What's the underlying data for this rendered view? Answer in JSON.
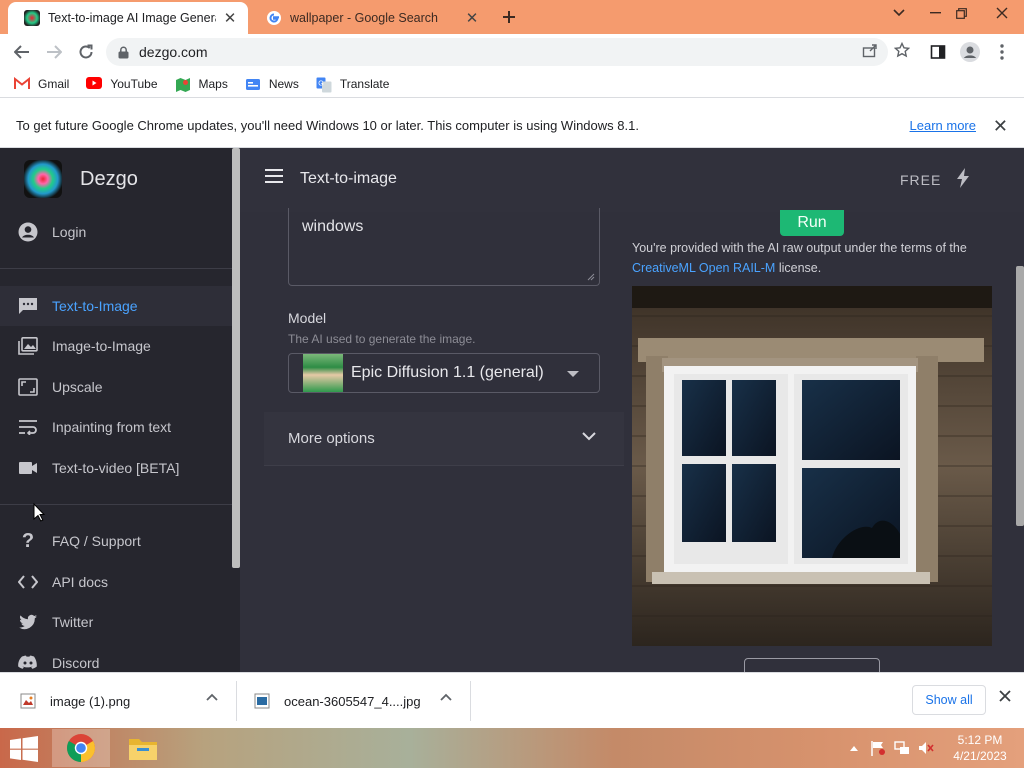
{
  "browser": {
    "tabs": [
      {
        "title": "Text-to-image AI Image Generato",
        "active": true
      },
      {
        "title": "wallpaper - Google Search",
        "active": false
      }
    ],
    "url": "dezgo.com",
    "bookmarks": [
      {
        "label": "Gmail",
        "icon": "gmail-icon"
      },
      {
        "label": "YouTube",
        "icon": "youtube-icon"
      },
      {
        "label": "Maps",
        "icon": "maps-icon"
      },
      {
        "label": "News",
        "icon": "news-icon"
      },
      {
        "label": "Translate",
        "icon": "translate-icon"
      }
    ],
    "infobar": {
      "message": "To get future Google Chrome updates, you'll need Windows 10 or later. This computer is using Windows 8.1.",
      "link": "Learn more"
    }
  },
  "app": {
    "brand": "Dezgo",
    "title": "Text-to-image",
    "plan": "FREE",
    "sidebar": {
      "login": "Login",
      "tools": [
        {
          "label": "Text-to-Image",
          "icon": "chat-icon",
          "selected": true
        },
        {
          "label": "Image-to-Image",
          "icon": "image-icon",
          "selected": false
        },
        {
          "label": "Upscale",
          "icon": "upscale-icon",
          "selected": false
        },
        {
          "label": "Inpainting from text",
          "icon": "wrap-text-icon",
          "selected": false
        },
        {
          "label": "Text-to-video [BETA]",
          "icon": "video-icon",
          "selected": false
        }
      ],
      "links": [
        {
          "label": "FAQ / Support",
          "icon": "help-icon"
        },
        {
          "label": "API docs",
          "icon": "code-icon"
        },
        {
          "label": "Twitter",
          "icon": "twitter-icon"
        },
        {
          "label": "Discord",
          "icon": "discord-icon"
        }
      ]
    },
    "form": {
      "prompt": "windows",
      "model_label": "Model",
      "model_help": "The AI used to generate the image.",
      "model_selected": "Epic Diffusion 1.1 (general)",
      "more_options": "More options"
    },
    "result": {
      "run": "Run",
      "license_prefix": "You're provided with the AI raw output under the terms of the",
      "license_link": "CreativeML Open RAIL-M",
      "license_suffix": "license."
    }
  },
  "downloads": {
    "items": [
      {
        "name": "image (1).png"
      },
      {
        "name": "ocean-3605547_4....jpg"
      }
    ],
    "show_all": "Show all"
  },
  "taskbar": {
    "time": "5:12 PM",
    "date": "4/21/2023"
  }
}
